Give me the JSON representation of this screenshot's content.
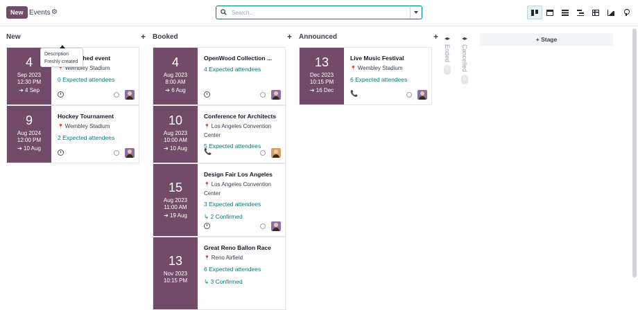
{
  "toolbar": {
    "new_label": "New",
    "breadcrumb": "Events",
    "search_placeholder": "Search...",
    "views": [
      {
        "name": "kanban",
        "active": true
      },
      {
        "name": "calendar"
      },
      {
        "name": "list"
      },
      {
        "name": "gantt"
      },
      {
        "name": "pivot"
      },
      {
        "name": "graph"
      },
      {
        "name": "map"
      }
    ]
  },
  "tooltip": {
    "title": "Description",
    "body": "Freshly created"
  },
  "columns": [
    {
      "title": "New",
      "cards": [
        {
          "day": "4",
          "month_year": "Sep 2023",
          "time": "12:30 PM",
          "end": "4 Sep",
          "title": "Unpublished event",
          "location": "Wembley Stadium",
          "expected": "0 Expected attendees",
          "footer_icon": "clock",
          "avatar": "a1"
        },
        {
          "day": "9",
          "month_year": "Aug 2024",
          "time": "12:00 PM",
          "end": "10 Aug",
          "title": "Hockey Tournament",
          "location": "Wembley Stadium",
          "expected": "2 Expected attendees",
          "footer_icon": "clock",
          "avatar": "a1"
        }
      ]
    },
    {
      "title": "Booked",
      "cards": [
        {
          "day": "4",
          "month_year": "Aug 2023",
          "time": "8:00 AM",
          "end": "6 Aug",
          "title": "OpenWood Collection ...",
          "location": "",
          "expected": "4 Expected attendees",
          "footer_icon": "clock",
          "avatar": "a1"
        },
        {
          "day": "10",
          "month_year": "Aug 2023",
          "time": "10:00 AM",
          "end": "10 Aug",
          "title": "Conference for Architects",
          "location": "Los Angeles Convention Center",
          "expected": "5 Expected attendees",
          "footer_icon": "phone",
          "avatar": "a2"
        },
        {
          "day": "15",
          "month_year": "Aug 2023",
          "time": "11:00 AM",
          "end": "19 Aug",
          "title": "Design Fair Los Angeles",
          "location": "Los Angeles Convention Center",
          "expected": "3 Expected attendees",
          "confirmed": "2 Confirmed",
          "footer_icon": "clock",
          "avatar": "a1"
        },
        {
          "day": "13",
          "month_year": "Nov 2023",
          "time": "10:15 PM",
          "end": "",
          "title": "Great Reno Ballon Race",
          "location": "Reno Airfield",
          "expected": "6 Expected attendees",
          "confirmed": "3 Confirmed",
          "footer_icon": "",
          "avatar": ""
        }
      ]
    },
    {
      "title": "Announced",
      "cards": [
        {
          "day": "13",
          "month_year": "Dec 2023",
          "time": "10:15 PM",
          "end": "16 Dec",
          "title": "Live Music Festival",
          "location": "Wembley Stadium",
          "expected": "6 Expected attendees",
          "footer_icon": "phone",
          "avatar": "a1"
        }
      ]
    }
  ],
  "folded": [
    {
      "label": "Ended",
      "count": "1"
    },
    {
      "label": "Cancelled",
      "count": "0"
    }
  ],
  "add_stage_label": "Stage",
  "colors": {
    "brand": "#714b67",
    "accent": "#017e84"
  }
}
